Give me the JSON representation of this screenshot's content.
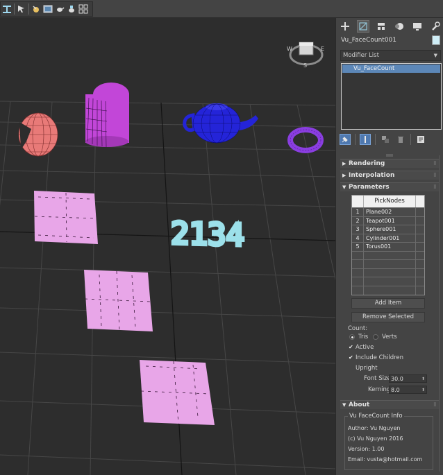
{
  "toolbar": {
    "buttons": [
      "align-icon",
      "select-manipulate-icon",
      "snap-icon",
      "render-frame-icon",
      "teapot-render-icon",
      "render-setup-icon",
      "layout-icon"
    ]
  },
  "viewport": {
    "label_text": "2134",
    "viewcube_label_top": "E",
    "viewcube_label_left": "W",
    "viewcube_label_bottom": "S",
    "colors": {
      "grid": "#4a4a4a",
      "grid_axis": "#111111",
      "pink_planes": "#e8a6e8",
      "sphere": "#e87a78",
      "cylinder": "#c246d8",
      "teapot": "#2424d8",
      "torus": "#8a3ee0",
      "text_shape": "#9ce0ea"
    }
  },
  "panel": {
    "tabs": [
      "create-icon",
      "modify-icon",
      "hierarchy-icon",
      "motion-icon",
      "display-icon",
      "utilities-icon"
    ],
    "object_name": "Vu_FaceCount001",
    "object_color": "#cfeef7",
    "modifier_list_label": "Modifier List",
    "stack_item": "Vu_FaceCount",
    "rollouts": {
      "rendering": "Rendering",
      "interpolation": "Interpolation",
      "parameters": "Parameters",
      "about": "About"
    },
    "picknodes": {
      "header": "PickNodes",
      "rows": [
        {
          "index": "1",
          "name": "Plane002"
        },
        {
          "index": "2",
          "name": "Teapot001"
        },
        {
          "index": "3",
          "name": "Sphere001"
        },
        {
          "index": "4",
          "name": "Cylinder001"
        },
        {
          "index": "5",
          "name": "Torus001"
        }
      ]
    },
    "add_item": "Add Item",
    "remove_selected": "Remove Selected",
    "count_label": "Count:",
    "count_tris": "Tris",
    "count_verts": "Verts",
    "active_label": "Active",
    "include_children_label": "Include Children",
    "upright_label": "Upright",
    "font_size_label": "Font Size",
    "font_size_value": "30.0",
    "kerning_label": "Kerning",
    "kerning_value": "8.0",
    "about_title": "Vu FaceCount Info",
    "about_author": "Author: Vu Nguyen",
    "about_copyright": "(c) Vu Nguyen 2016",
    "about_version": "Version: 1.00",
    "about_email": "Email: vusta@hotmail.com"
  }
}
